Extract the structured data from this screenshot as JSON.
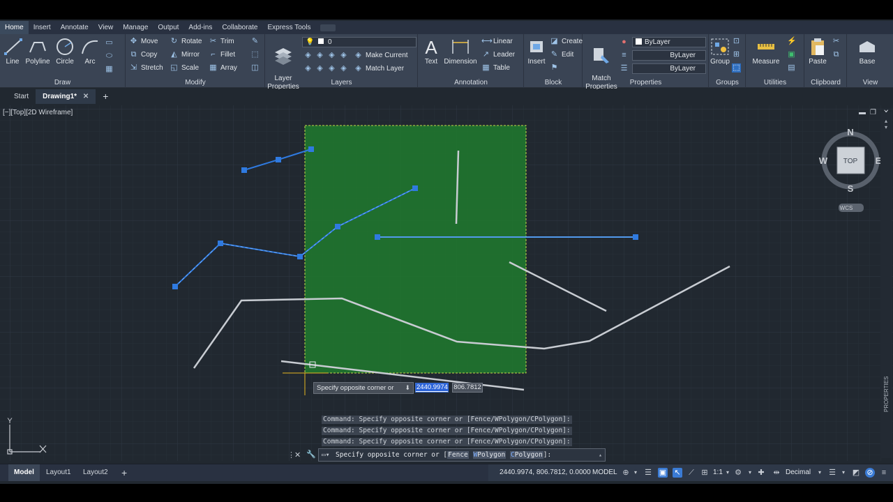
{
  "ribbon_tabs": [
    "Home",
    "Insert",
    "Annotate",
    "View",
    "Manage",
    "Output",
    "Add-ins",
    "Collaborate",
    "Express Tools"
  ],
  "draw": {
    "line": "Line",
    "polyline": "Polyline",
    "circle": "Circle",
    "arc": "Arc",
    "title": "Draw"
  },
  "modify": {
    "move": "Move",
    "rotate": "Rotate",
    "trim": "Trim",
    "copy": "Copy",
    "mirror": "Mirror",
    "fillet": "Fillet",
    "stretch": "Stretch",
    "scale": "Scale",
    "array": "Array",
    "title": "Modify"
  },
  "layers": {
    "layer_properties": "Layer\nProperties",
    "current_layer": "0",
    "make_current": "Make Current",
    "match_layer": "Match Layer",
    "title": "Layers"
  },
  "annotation": {
    "text": "Text",
    "dimension": "Dimension",
    "linear": "Linear",
    "leader": "Leader",
    "table": "Table",
    "title": "Annotation"
  },
  "block": {
    "insert": "Insert",
    "create": "Create",
    "edit": "Edit",
    "title": "Block"
  },
  "properties": {
    "match_properties": "Match\nProperties",
    "color": "ByLayer",
    "linetype": "ByLayer",
    "lineweight": "ByLayer",
    "title": "Properties"
  },
  "groups": {
    "group": "Group",
    "title": "Groups"
  },
  "utilities": {
    "measure": "Measure",
    "title": "Utilities"
  },
  "clipboard": {
    "paste": "Paste",
    "title": "Clipboard"
  },
  "view_panel": {
    "base": "Base",
    "title": "View"
  },
  "file_tabs": {
    "start": "Start",
    "drawing": "Drawing1*"
  },
  "viewport_controls": "[−][Top][2D Wireframe]",
  "viewcube": {
    "n": "N",
    "s": "S",
    "e": "E",
    "w": "W",
    "top": "TOP",
    "wcs": "WCS"
  },
  "ucs": {
    "y": "Y"
  },
  "dynamic_input": {
    "prompt": "Specify opposite corner or",
    "x": "2440.9974",
    "y": "806.7812"
  },
  "command_history": [
    "Command: Specify opposite corner or [Fence/WPolygon/CPolygon]:",
    "Command: Specify opposite corner or [Fence/WPolygon/CPolygon]:",
    "Command: Specify opposite corner or [Fence/WPolygon/CPolygon]:"
  ],
  "command_line": {
    "prefix": "Specify opposite corner or [",
    "fence": "Fence",
    "wpolygon_key": "W",
    "wpolygon": "Polygon",
    "cpolygon_key": "C",
    "cpolygon": "Polygon",
    "suffix": "]:"
  },
  "properties_palette": "PROPERTIES",
  "status": {
    "model_tab": "Model",
    "layout1": "Layout1",
    "layout2": "Layout2",
    "coordinates": "2440.9974, 806.7812, 0.0000",
    "model": "MODEL",
    "scale": "1:1",
    "units": "Decimal"
  },
  "colors": {
    "selection_fill": "#1f7a2e",
    "grip": "#2f7ae0",
    "accent": "#3a7bd5"
  }
}
